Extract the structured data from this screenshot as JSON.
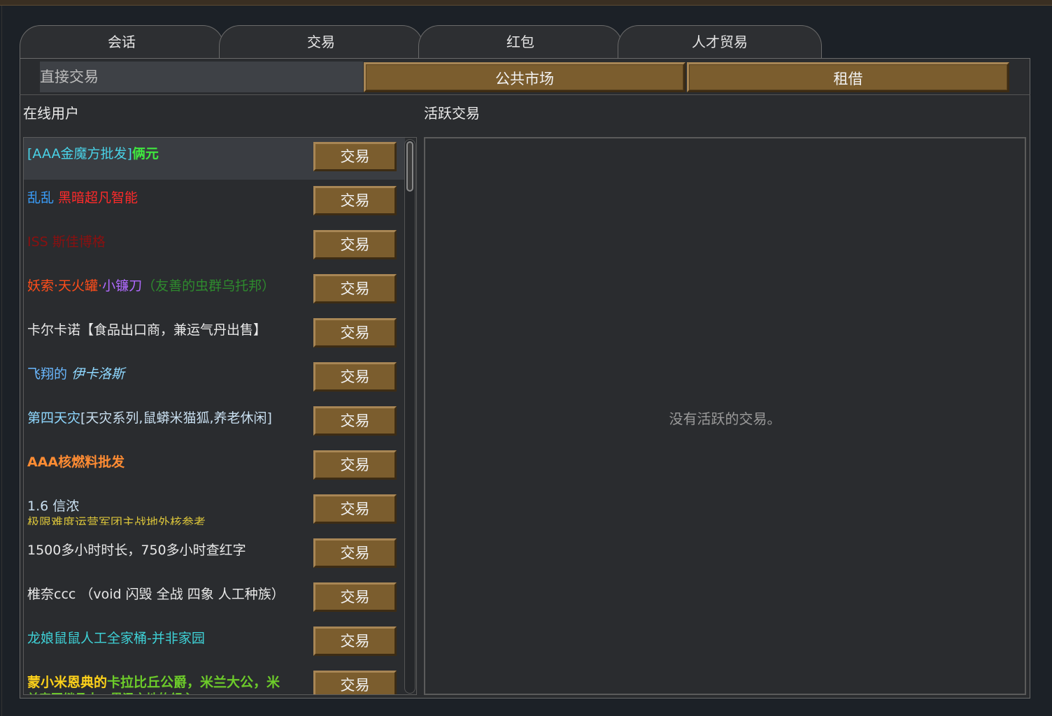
{
  "tabs": [
    "会话",
    "交易",
    "红包",
    "人才贸易"
  ],
  "toolbar": {
    "direct_trade": "直接交易",
    "public_market": "公共市场",
    "rent": "租借"
  },
  "labels": {
    "online_users": "在线用户",
    "active_trades": "活跃交易"
  },
  "trade_panel": {
    "empty_message": "没有活跃的交易。"
  },
  "trade_button_label": "交易",
  "users": [
    {
      "name": [
        {
          "t": "[AAA金魔方批发]",
          "c": "#49d3e8"
        },
        {
          "t": "俩元",
          "c": "#3fe83f"
        }
      ]
    },
    {
      "name": [
        {
          "t": " 乱乱 ",
          "c": "#3aa0ff"
        },
        {
          "t": "黑暗超凡智能",
          "c": "#ff2a2a"
        }
      ]
    },
    {
      "name": [
        {
          "t": " ISS 斯佳博格",
          "c": "#8a1010"
        }
      ]
    },
    {
      "name": [
        {
          "t": "妖索·天火罐·",
          "c": "#ff4d1a"
        },
        {
          "t": "小镰刀",
          "c": "#b06aff"
        },
        {
          "t": "（友善的虫群乌托邦）",
          "c": "#2e8b2e"
        }
      ]
    },
    {
      "name": [
        {
          "t": "卡尔卡诺【食品出口商，兼运气丹出售】",
          "c": "#e8e8e8"
        }
      ]
    },
    {
      "name": [
        {
          "t": "飞翔的 ",
          "c": "#6ab8ff"
        },
        {
          "t": "伊卡洛斯",
          "c": "#8fd8ff"
        }
      ]
    },
    {
      "name": [
        {
          "t": "第四天灾",
          "c": "#8fd8ff"
        },
        {
          "t": "[天灾系列,鼠蟒米猫狐,养老休闲]",
          "c": "#c9dff0"
        }
      ]
    },
    {
      "name": [
        {
          "t": "AAA核燃料批发",
          "c": "#ff8c33"
        }
      ]
    },
    {
      "name": [
        {
          "t": "1.6 信浓",
          "c": "#c9dff0"
        }
      ],
      "sub": [
        {
          "t": "极限难度运营军团主战地外核参考",
          "c": "#d8c23a"
        }
      ]
    },
    {
      "name": [
        {
          "t": "1500多小时时长，750多小时查红字",
          "c": "#e8e8e8"
        }
      ]
    },
    {
      "name": [
        {
          "t": "椎奈ccc （void 闪毁 全战 四象 人工种族）",
          "c": "#e8e8e8"
        }
      ]
    },
    {
      "name": [
        {
          "t": "龙娘鼠鼠人工全家桶-并非家园",
          "c": "#3ed1d6"
        }
      ]
    },
    {
      "name": [
        {
          "t": "蒙小米恩典的",
          "c": "#ffd21a"
        },
        {
          "t": "卡拉比丘公爵，米兰大公，米",
          "c": "#6dcc2a"
        }
      ],
      "sub": [
        {
          "t": "兰帝国继承人，恩泽之地的领主",
          "c": "#6dcc2a"
        }
      ]
    }
  ]
}
